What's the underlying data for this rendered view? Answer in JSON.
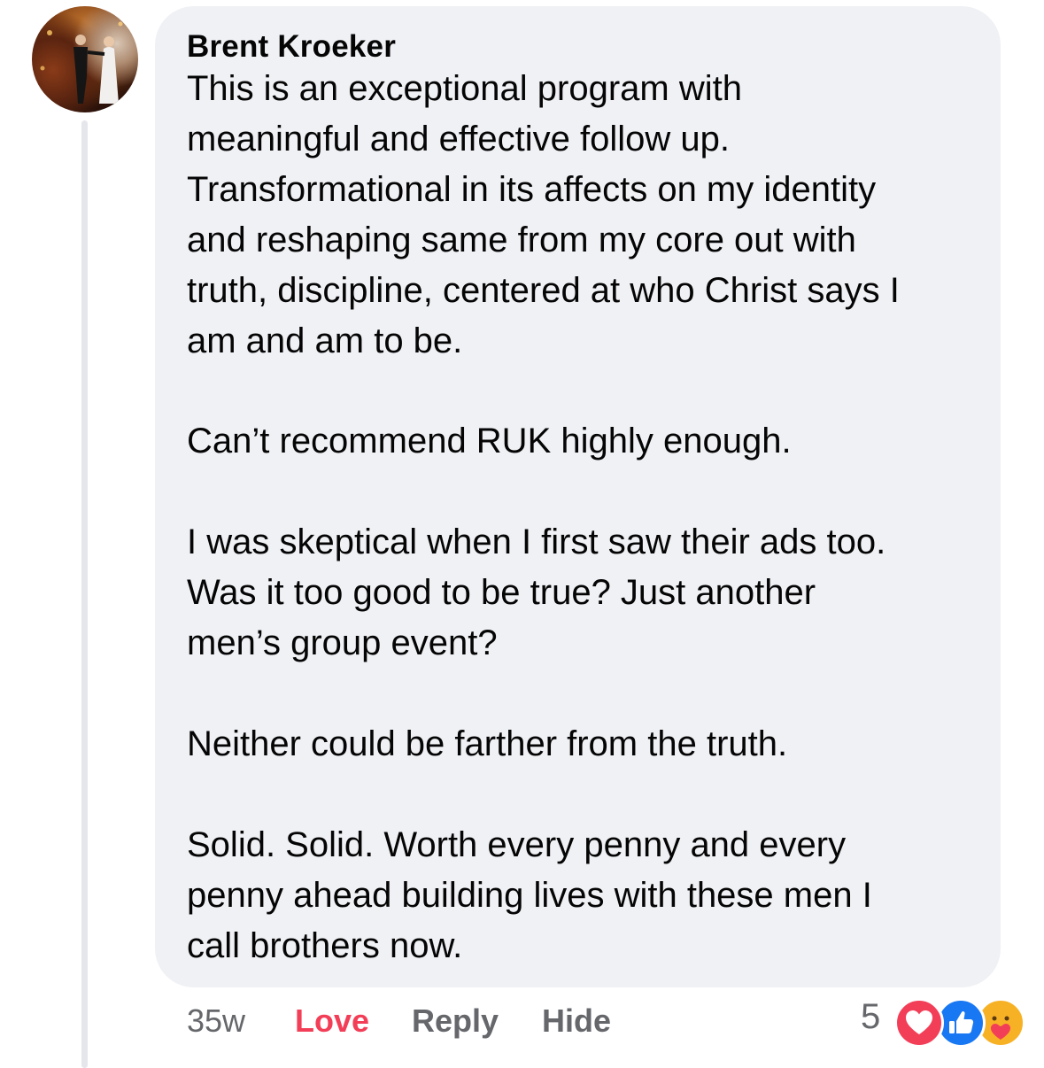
{
  "comment": {
    "author": "Brent Kroeker",
    "paragraphs": [
      [
        "This is an exceptional program with",
        "meaningful and effective follow up.",
        "Transformational in its affects on my identity",
        "and reshaping same from my core out with",
        "truth, discipline, centered at who Christ says I",
        "am and am to be."
      ],
      [
        "Can’t recommend RUK highly enough."
      ],
      [
        "I was skeptical when I first saw their ads too.",
        "Was it too good to be true?  Just another",
        "men’s group event?"
      ],
      [
        "Neither could be farther from the truth."
      ],
      [
        "Solid. Solid. Worth every penny and every",
        "penny ahead building lives with these men I",
        "call brothers now."
      ]
    ]
  },
  "actions": {
    "time": "35w",
    "love": "Love",
    "reply": "Reply",
    "hide": "Hide"
  },
  "reactions": {
    "count": "5",
    "icons": [
      "heart-reaction-icon",
      "like-reaction-icon",
      "care-reaction-icon"
    ]
  },
  "colors": {
    "bubble": "#f0f1f5",
    "love_active": "#f33e58",
    "meta_text": "#65676b",
    "like_blue": "#1877f2",
    "heart_red": "#f33e58",
    "care_yellow": "#f7b125"
  }
}
